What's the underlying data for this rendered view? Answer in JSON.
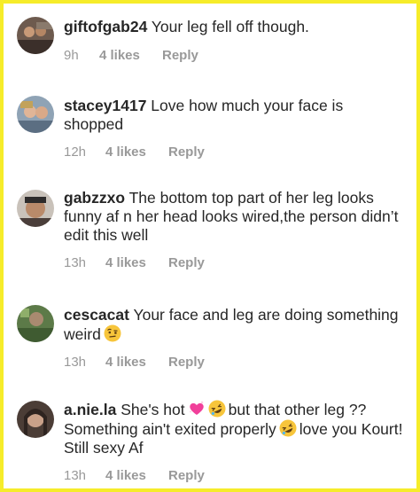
{
  "comments": [
    {
      "username": "giftofgab24",
      "text": " Your leg fell off though.",
      "time": "9h",
      "likes": "4 likes",
      "reply": "Reply"
    },
    {
      "username": "stacey1417",
      "text": " Love how much your face is shopped",
      "time": "12h",
      "likes": "4 likes",
      "reply": "Reply"
    },
    {
      "username": "gabzzxo",
      "text": " The bottom top part of her leg looks funny af n her head looks wired,the person didn’t edit this well",
      "time": "13h",
      "likes": "4 likes",
      "reply": "Reply"
    },
    {
      "username": "cescacat",
      "text": " Your face and leg are doing something weird",
      "time": "13h",
      "likes": "4 likes",
      "reply": "Reply"
    },
    {
      "username": "a.nie.la",
      "text_1": " She's hot",
      "text_2": "but that other leg ?? Something ain't exited properly",
      "text_3": "love you Kourt! Still sexy Af",
      "time": "13h",
      "likes": "4 likes",
      "reply": "Reply"
    }
  ],
  "icons": {
    "raised-eyebrow-emoji": "face-with-raised-eyebrow",
    "heart-emoji": "sparkling-heart",
    "laughing-emoji": "rolling-on-the-floor-laughing"
  },
  "colors": {
    "border": "#f6ec2a",
    "text": "#262626",
    "meta": "#999999"
  }
}
